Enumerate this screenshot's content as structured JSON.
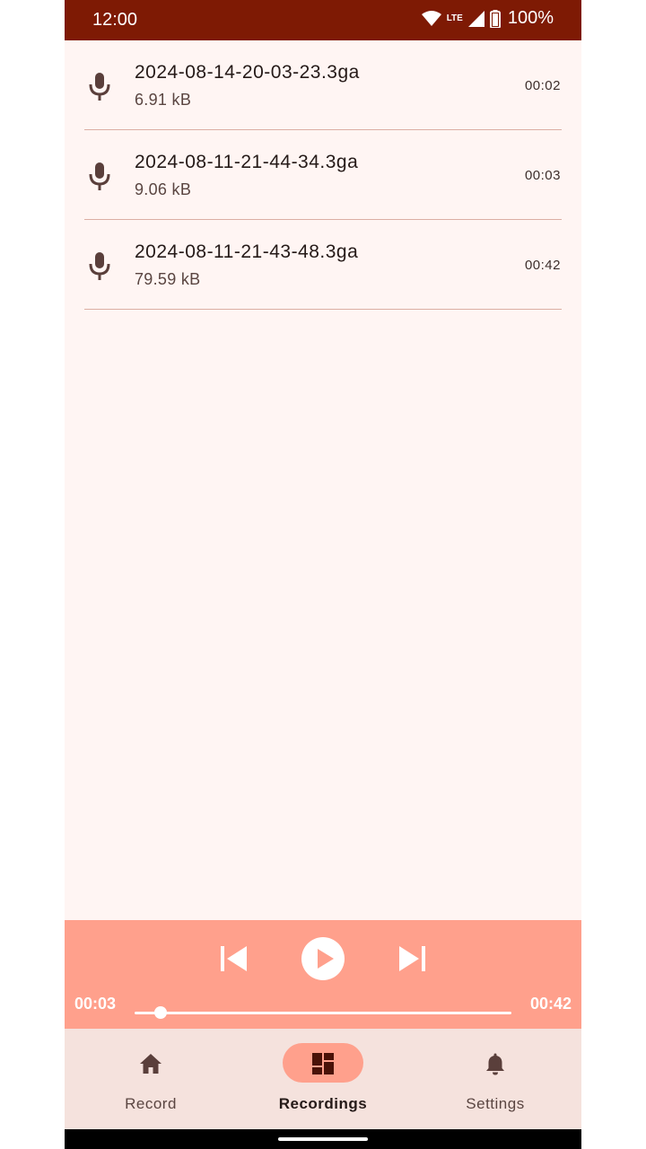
{
  "status": {
    "time": "12:00",
    "network": "LTE",
    "battery": "100%"
  },
  "recordings": [
    {
      "name": "2024-08-14-20-03-23.3ga",
      "size": "6.91 kB",
      "duration": "00:02"
    },
    {
      "name": "2024-08-11-21-44-34.3ga",
      "size": "9.06 kB",
      "duration": "00:03"
    },
    {
      "name": "2024-08-11-21-43-48.3ga",
      "size": "79.59 kB",
      "duration": "00:42"
    }
  ],
  "player": {
    "current": "00:03",
    "total": "00:42",
    "progress": 0.07
  },
  "nav": {
    "items": [
      {
        "label": "Record",
        "icon": "home-icon"
      },
      {
        "label": "Recordings",
        "icon": "dashboard-icon",
        "active": true
      },
      {
        "label": "Settings",
        "icon": "bell-icon"
      }
    ]
  },
  "colors": {
    "status_bar": "#7e1a04",
    "background": "#fff5f3",
    "player": "#ffa08c",
    "nav": "#f5e2dd",
    "active_pill": "#ffa08c"
  }
}
